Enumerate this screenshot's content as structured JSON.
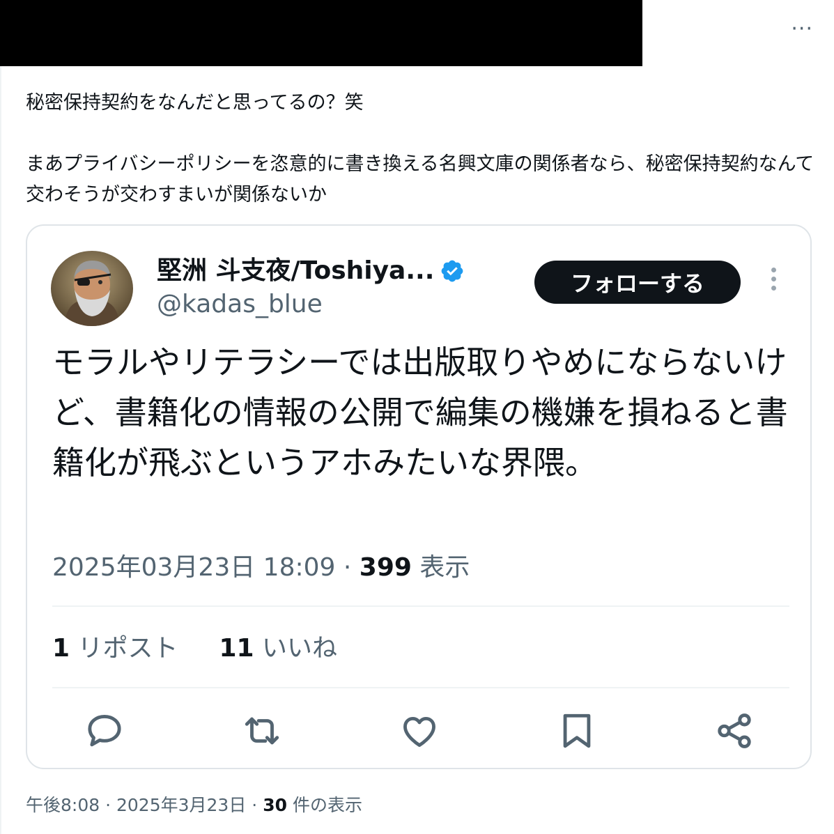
{
  "top_menu": {
    "icon": "more-horizontal-icon",
    "label": "···"
  },
  "post": {
    "text_line1": "秘密保持契約をなんだと思ってるの？笑",
    "text_line2": "まあプライバシーポリシーを恣意的に書き換える名興文庫の関係者なら、秘密保持契約なんて交わそうが交わすまいが関係ないか"
  },
  "quoted": {
    "author_name": "堅洲 斗支夜/Toshiya...",
    "handle": "@kadas_blue",
    "verified_icon": "verified-badge-icon",
    "follow_label": "フォローする",
    "text": "モラルやリテラシーでは出版取りやめにならないけど、書籍化の情報の公開で編集の機嫌を損ねると書籍化が飛ぶというアホみたいな界隈。",
    "timestamp": "2025年03月23日 18:09",
    "separator": "·",
    "views_count": "399",
    "views_label": "表示",
    "reposts_count": "1",
    "reposts_label": "リポスト",
    "likes_count": "11",
    "likes_label": "いいね",
    "actions": [
      "reply-icon",
      "repost-icon",
      "like-icon",
      "bookmark-icon",
      "share-icon"
    ]
  },
  "footer": {
    "time": "午後8:08",
    "separator": "·",
    "date": "2025年3月23日",
    "views_count": "30",
    "views_label": "件の表示"
  },
  "colors": {
    "text_primary": "#0f1419",
    "text_secondary": "#536471",
    "verified_blue": "#1d9bf0",
    "border": "#dfe4e8"
  }
}
